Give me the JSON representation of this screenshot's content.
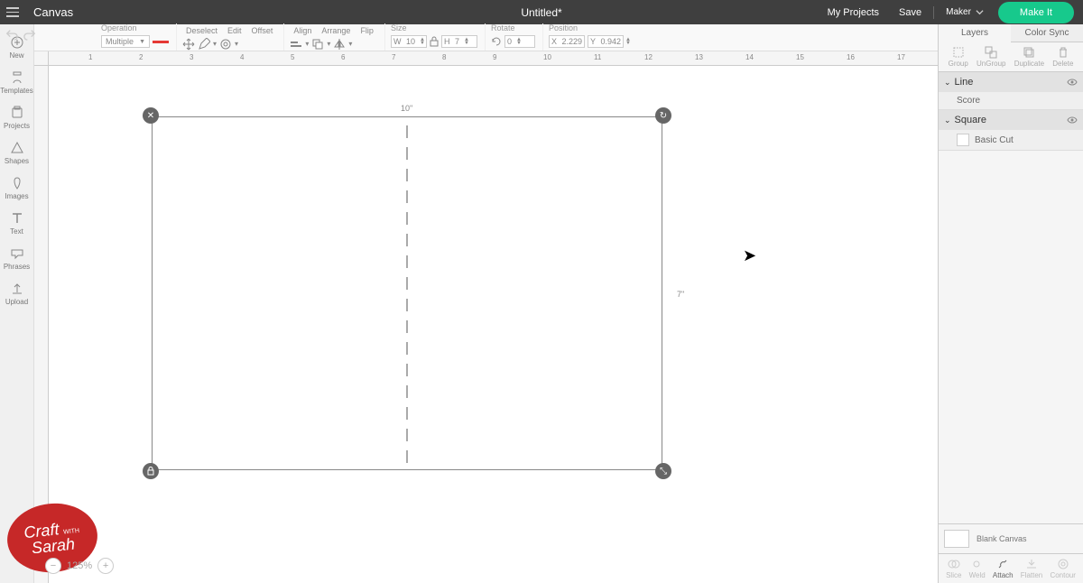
{
  "header": {
    "app": "Canvas",
    "doc": "Untitled*",
    "my_projects": "My Projects",
    "save": "Save",
    "machine": "Maker",
    "make_it": "Make It"
  },
  "toolbar": {
    "operation": {
      "label": "Operation",
      "value": "Multiple"
    },
    "deselect": "Deselect",
    "edit": "Edit",
    "offset": "Offset",
    "align": "Align",
    "arrange": "Arrange",
    "flip": "Flip",
    "size": {
      "label": "Size",
      "w": "10",
      "h": "7"
    },
    "rotate": {
      "label": "Rotate",
      "deg": "0"
    },
    "position": {
      "label": "Position",
      "x": "2.229",
      "y": "0.942"
    }
  },
  "left_tools": [
    {
      "name": "new",
      "label": "New"
    },
    {
      "name": "templates",
      "label": "Templates"
    },
    {
      "name": "projects",
      "label": "Projects"
    },
    {
      "name": "shapes",
      "label": "Shapes"
    },
    {
      "name": "images",
      "label": "Images"
    },
    {
      "name": "text",
      "label": "Text"
    },
    {
      "name": "phrases",
      "label": "Phrases"
    },
    {
      "name": "upload",
      "label": "Upload"
    }
  ],
  "ruler_ticks": [
    "1",
    "2",
    "3",
    "4",
    "5",
    "6",
    "7",
    "8",
    "9",
    "10",
    "11",
    "12",
    "13",
    "14",
    "15",
    "16",
    "17"
  ],
  "selection": {
    "width_label": "10\"",
    "height_label": "7\""
  },
  "right": {
    "tabs": {
      "layers": "Layers",
      "color_sync": "Color Sync"
    },
    "top_ops": {
      "group": "Group",
      "ungroup": "UnGroup",
      "duplicate": "Duplicate",
      "delete": "Delete"
    },
    "layers": [
      {
        "name": "Line",
        "child": "Score"
      },
      {
        "name": "Square",
        "child": "Basic Cut"
      }
    ],
    "canvas_opt": "Blank Canvas",
    "bottom_ops": {
      "slice": "Slice",
      "weld": "Weld",
      "attach": "Attach",
      "flatten": "Flatten",
      "contour": "Contour"
    }
  },
  "zoom": "125%",
  "logo": {
    "line1": "Craft",
    "line2": "Sarah",
    "with": "WITH"
  }
}
